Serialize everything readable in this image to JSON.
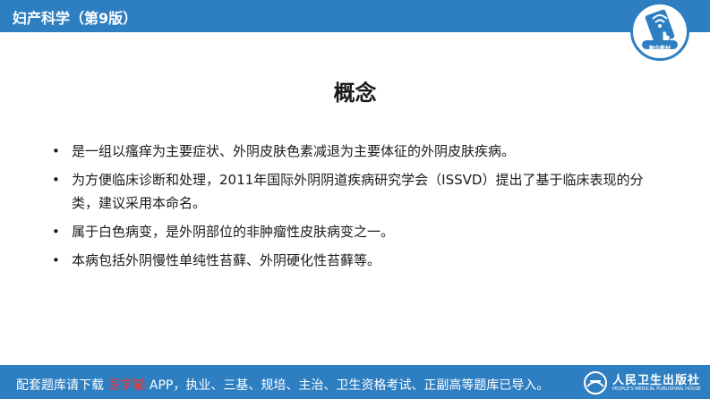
{
  "header": {
    "title": "妇产科学（第9版）"
  },
  "badge": {
    "label": "融合教材",
    "icon": "touch-tablet-icon"
  },
  "slide": {
    "title": "概念",
    "bullets": [
      {
        "marker": "•",
        "text": "是一组以瘙痒为主要症状、外阴皮肤色素减退为主要体征的外阴皮肤疾病。"
      },
      {
        "marker": "•",
        "text": "为方便临床诊断和处理，2011年国际外阴阴道疾病研究学会（ISSVD）提出了基于临床表现的分类，建议采用本命名。"
      },
      {
        "marker": "•",
        "text": "属于白色病变，是外阴部位的非肿瘤性皮肤病变之一。"
      },
      {
        "marker": "•",
        "text": "本病包括外阴慢性单纯性苔藓、外阴硬化性苔藓等。"
      }
    ]
  },
  "footer": {
    "text_before": "配套题库请下载 ",
    "highlight": "医学猫",
    "text_after": " APP，执业、三基、规培、主治、卫生资格考试、正副高等题库已导入。",
    "publisher_name": "人民卫生出版社",
    "publisher_en": "PEOPLE'S MEDICAL PUBLISHING HOUSE"
  },
  "colors": {
    "brand": "#2e7fc2",
    "highlight": "#e53935",
    "text": "#1a1a1a"
  }
}
